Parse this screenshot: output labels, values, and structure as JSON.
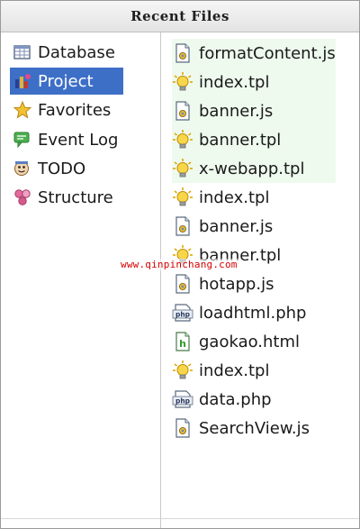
{
  "window": {
    "title": "Recent Files"
  },
  "sidebar": {
    "items": [
      {
        "label": "Database",
        "icon": "database-icon",
        "selected": false
      },
      {
        "label": "Project",
        "icon": "project-icon",
        "selected": true
      },
      {
        "label": "Favorites",
        "icon": "star-icon",
        "selected": false
      },
      {
        "label": "Event Log",
        "icon": "event-log-icon",
        "selected": false
      },
      {
        "label": "TODO",
        "icon": "todo-icon",
        "selected": false
      },
      {
        "label": "Structure",
        "icon": "structure-icon",
        "selected": false
      }
    ]
  },
  "files": [
    {
      "name": "formatContent.js",
      "icon": "js-file-icon",
      "highlighted": true
    },
    {
      "name": "index.tpl",
      "icon": "tpl-file-icon",
      "highlighted": true
    },
    {
      "name": "banner.js",
      "icon": "js-file-icon",
      "highlighted": true
    },
    {
      "name": "banner.tpl",
      "icon": "tpl-file-icon",
      "highlighted": true
    },
    {
      "name": "x-webapp.tpl",
      "icon": "tpl-file-icon",
      "highlighted": true
    },
    {
      "name": "index.tpl",
      "icon": "tpl-file-icon",
      "highlighted": false
    },
    {
      "name": "banner.js",
      "icon": "js-file-icon",
      "highlighted": false
    },
    {
      "name": "banner.tpl",
      "icon": "tpl-file-icon",
      "highlighted": false
    },
    {
      "name": "hotapp.js",
      "icon": "js-file-icon",
      "highlighted": false
    },
    {
      "name": "loadhtml.php",
      "icon": "php-file-icon",
      "highlighted": false
    },
    {
      "name": "gaokao.html",
      "icon": "html-file-icon",
      "highlighted": false
    },
    {
      "name": "index.tpl",
      "icon": "tpl-file-icon",
      "highlighted": false
    },
    {
      "name": "data.php",
      "icon": "php-file-icon",
      "highlighted": false
    },
    {
      "name": "SearchView.js",
      "icon": "js-file-icon",
      "highlighted": false
    }
  ],
  "watermark": "www.qinpinchang.com",
  "colors": {
    "selection": "#3d6fc7",
    "recent_highlight": "#eefaee",
    "watermark": "#d40000"
  }
}
